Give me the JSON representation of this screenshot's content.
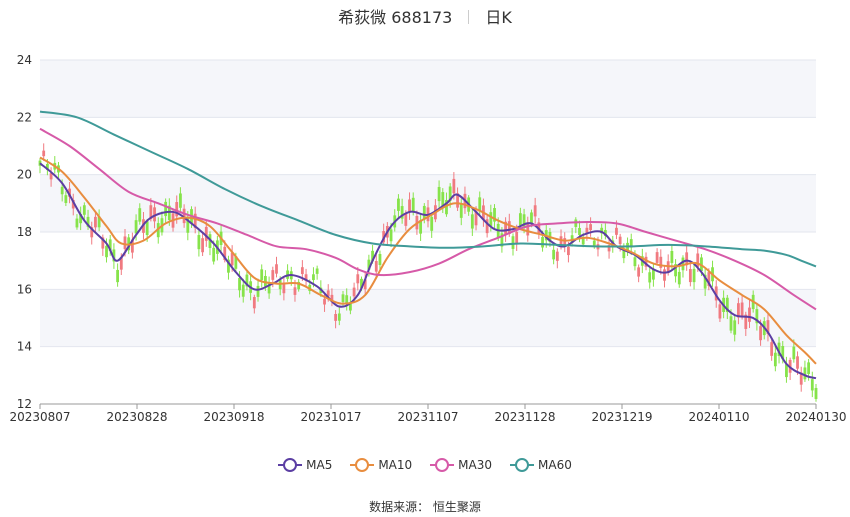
{
  "title": {
    "name": "希荻微 688173",
    "period": "日K"
  },
  "source": "数据来源： 恒生聚源",
  "chart_data": {
    "type": "candlestick",
    "ylim": [
      12,
      24
    ],
    "yticks": [
      12,
      14,
      16,
      18,
      20,
      22,
      24
    ],
    "xtick_labels": [
      "20230807",
      "20230828",
      "20230918",
      "20231017",
      "20231107",
      "20231128",
      "20231219",
      "20240110",
      "20240130"
    ],
    "colors": {
      "up": "#f07a80",
      "down": "#86e34a",
      "MA5": "#5b3ea3",
      "MA10": "#e88d3f",
      "MA30": "#d65aa8",
      "MA60": "#3f9a98"
    },
    "series": [
      {
        "name": "MA5",
        "anchors": [
          [
            0,
            20.4
          ],
          [
            6,
            19.7
          ],
          [
            12,
            18.4
          ],
          [
            18,
            17.6
          ],
          [
            21,
            17.0
          ],
          [
            26,
            17.9
          ],
          [
            30,
            18.5
          ],
          [
            36,
            18.7
          ],
          [
            41,
            18.3
          ],
          [
            47,
            17.6
          ],
          [
            53,
            16.6
          ],
          [
            58,
            16.0
          ],
          [
            63,
            16.2
          ],
          [
            68,
            16.5
          ],
          [
            75,
            16.1
          ],
          [
            81,
            15.4
          ],
          [
            86,
            15.8
          ],
          [
            90,
            17.0
          ],
          [
            95,
            18.2
          ],
          [
            100,
            18.7
          ],
          [
            105,
            18.6
          ],
          [
            110,
            19.0
          ],
          [
            113,
            19.3
          ],
          [
            118,
            18.7
          ],
          [
            123,
            18.1
          ],
          [
            128,
            18.1
          ],
          [
            133,
            18.3
          ],
          [
            138,
            17.7
          ],
          [
            142,
            17.5
          ],
          [
            147,
            17.9
          ],
          [
            152,
            18.0
          ],
          [
            156,
            17.5
          ],
          [
            161,
            17.2
          ],
          [
            166,
            16.7
          ],
          [
            170,
            16.6
          ],
          [
            175,
            17.0
          ],
          [
            179,
            16.6
          ],
          [
            184,
            15.6
          ],
          [
            188,
            15.1
          ],
          [
            193,
            15.0
          ],
          [
            197,
            14.5
          ],
          [
            202,
            13.4
          ],
          [
            207,
            13.0
          ],
          [
            210,
            12.9
          ]
        ]
      },
      {
        "name": "MA10",
        "anchors": [
          [
            0,
            20.6
          ],
          [
            6,
            20.1
          ],
          [
            12,
            19.2
          ],
          [
            18,
            18.2
          ],
          [
            22,
            17.6
          ],
          [
            28,
            17.7
          ],
          [
            34,
            18.3
          ],
          [
            40,
            18.5
          ],
          [
            46,
            18.2
          ],
          [
            52,
            17.3
          ],
          [
            58,
            16.4
          ],
          [
            64,
            16.2
          ],
          [
            70,
            16.2
          ],
          [
            76,
            15.8
          ],
          [
            82,
            15.5
          ],
          [
            88,
            15.8
          ],
          [
            94,
            17.1
          ],
          [
            100,
            18.1
          ],
          [
            106,
            18.6
          ],
          [
            112,
            19.0
          ],
          [
            118,
            18.8
          ],
          [
            124,
            18.4
          ],
          [
            130,
            18.1
          ],
          [
            136,
            17.9
          ],
          [
            142,
            17.7
          ],
          [
            148,
            17.8
          ],
          [
            154,
            17.6
          ],
          [
            160,
            17.3
          ],
          [
            166,
            16.9
          ],
          [
            172,
            16.8
          ],
          [
            178,
            16.9
          ],
          [
            184,
            16.3
          ],
          [
            190,
            15.8
          ],
          [
            196,
            15.3
          ],
          [
            202,
            14.4
          ],
          [
            207,
            13.8
          ],
          [
            210,
            13.4
          ]
        ]
      },
      {
        "name": "MA30",
        "anchors": [
          [
            0,
            21.6
          ],
          [
            8,
            21.0
          ],
          [
            16,
            20.2
          ],
          [
            24,
            19.4
          ],
          [
            32,
            19.0
          ],
          [
            40,
            18.6
          ],
          [
            48,
            18.3
          ],
          [
            56,
            17.9
          ],
          [
            64,
            17.5
          ],
          [
            72,
            17.4
          ],
          [
            80,
            17.1
          ],
          [
            86,
            16.7
          ],
          [
            92,
            16.5
          ],
          [
            100,
            16.6
          ],
          [
            108,
            16.9
          ],
          [
            116,
            17.4
          ],
          [
            124,
            17.8
          ],
          [
            132,
            18.2
          ],
          [
            140,
            18.3
          ],
          [
            148,
            18.35
          ],
          [
            156,
            18.3
          ],
          [
            164,
            18.0
          ],
          [
            172,
            17.7
          ],
          [
            180,
            17.4
          ],
          [
            188,
            17.0
          ],
          [
            196,
            16.5
          ],
          [
            204,
            15.8
          ],
          [
            210,
            15.3
          ]
        ]
      },
      {
        "name": "MA60",
        "anchors": [
          [
            0,
            22.2
          ],
          [
            10,
            22.0
          ],
          [
            20,
            21.4
          ],
          [
            30,
            20.8
          ],
          [
            40,
            20.2
          ],
          [
            50,
            19.5
          ],
          [
            60,
            18.9
          ],
          [
            70,
            18.4
          ],
          [
            80,
            17.9
          ],
          [
            90,
            17.6
          ],
          [
            100,
            17.5
          ],
          [
            110,
            17.45
          ],
          [
            120,
            17.5
          ],
          [
            130,
            17.6
          ],
          [
            140,
            17.55
          ],
          [
            150,
            17.5
          ],
          [
            160,
            17.5
          ],
          [
            170,
            17.55
          ],
          [
            180,
            17.5
          ],
          [
            190,
            17.4
          ],
          [
            196,
            17.35
          ],
          [
            202,
            17.2
          ],
          [
            206,
            17.0
          ],
          [
            210,
            16.8
          ]
        ]
      }
    ]
  }
}
